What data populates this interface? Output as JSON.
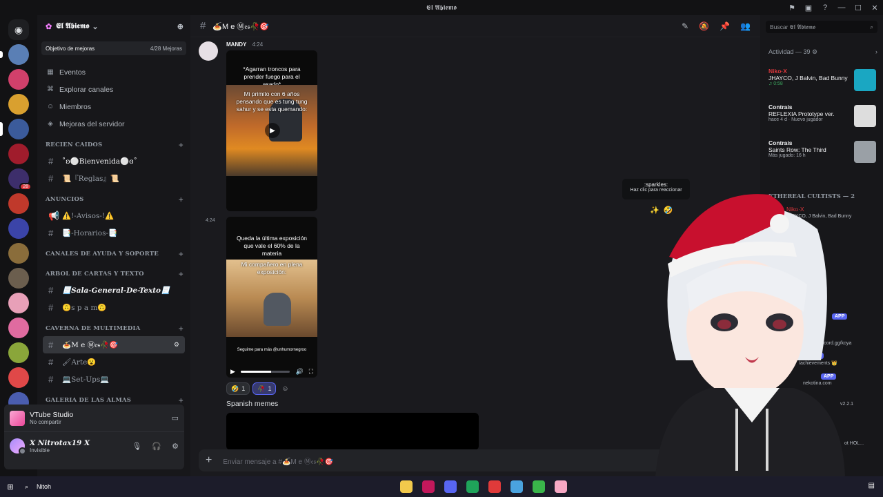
{
  "window": {
    "title": "𝕰𝖑 𝕬𝖇𝖎𝖊𝖒𝖔",
    "controls": [
      "—",
      "☐",
      "✕"
    ]
  },
  "server": {
    "name": "𝕰𝖑 𝕬𝖇𝖎𝖊𝖒𝖔",
    "boost_label": "Objetivo de mejoras",
    "boost_count": "4/28 Mejoras"
  },
  "menu": [
    {
      "icon": "calendar-icon",
      "glyph": "▦",
      "label": "Eventos"
    },
    {
      "icon": "compass-icon",
      "glyph": "⌘",
      "label": "Explorar canales"
    },
    {
      "icon": "members-icon",
      "glyph": "☺",
      "label": "Miembros"
    },
    {
      "icon": "boost-icon",
      "glyph": "◈",
      "label": "Mejoras del servidor"
    }
  ],
  "categories": [
    {
      "label": "RECIEN CAIDOS",
      "channels": [
        {
          "name": "˚ʚ⚪Bienvenida⚪ɞ˚",
          "icon": "#",
          "state": "unread"
        },
        {
          "name": "📜『Reglas』📜",
          "icon": "#",
          "state": "normal"
        }
      ]
    },
    {
      "label": "ANUNCIOS",
      "channels": [
        {
          "name": "⚠️!-Avisos-!⚠️",
          "icon": "📢",
          "state": "normal"
        },
        {
          "name": "📑-Horarios-📑",
          "icon": "#",
          "state": "normal"
        }
      ]
    },
    {
      "label": "CANALES DE AYUDA Y SOPORTE",
      "channels": []
    },
    {
      "label": "ARBOL DE CARTAS Y TEXTO",
      "channels": [
        {
          "name": "📃Sala-General-De-Texto📃",
          "icon": "#",
          "state": "unread"
        },
        {
          "name": "🙃s p a m🙃",
          "icon": "#",
          "state": "normal"
        }
      ]
    },
    {
      "label": "CAVERNA DE MULTIMEDIA",
      "channels": [
        {
          "name": "🍝M e Ⓜ𝔢𝔰🥀🎯",
          "icon": "#",
          "state": "active"
        },
        {
          "name": "🖌Arte😮",
          "icon": "#",
          "state": "normal"
        },
        {
          "name": "💻Set-Ups💻",
          "icon": "#",
          "state": "normal"
        }
      ]
    },
    {
      "label": "GALERIA DE LAS ALMAS",
      "channels": []
    }
  ],
  "voice": {
    "app": "VTube Studio",
    "status": "No compartir"
  },
  "user": {
    "name": "𝑿 𝑵𝒊𝒕𝒓𝒐𝒕𝒂𝒙19 𝑿",
    "status": "Invisible"
  },
  "chat": {
    "channel_title": "🍝M e Ⓜ𝔢𝔰🥀🎯",
    "author": "MANDY",
    "time": "4:24",
    "time2": "4:24",
    "video1_caption_top": "*Agarran troncos para prender fuego para el asado*",
    "video1_caption_mid": "Mi primito con 6 años pensando que es tung tung sahur y se esta quemando:",
    "video2_caption_top": "Queda la última exposición que vale el 60% de la materia",
    "video2_caption_mid": "Mi compañero en plena exposición:",
    "video2_caption_bottom": "Seguime para más @unhumornegroo",
    "video2_progress": 0.62,
    "reactions": [
      {
        "emoji": "🤣",
        "count": "1",
        "mine": false
      },
      {
        "emoji": "🥀",
        "count": "1",
        "mine": true
      }
    ],
    "text": "Spanish memes",
    "composer_placeholder": "Enviar mensaje a #🍝M e Ⓜ𝔢𝔰🥀🎯",
    "tooltip_title": ":sparkles:",
    "tooltip_sub": "Haz clic para reaccionar"
  },
  "members": {
    "search_placeholder": "Buscar 𝕰𝖑 𝕬𝖇𝖎𝖊𝖒𝖔",
    "activity_header": "Actividad — 39",
    "activities": [
      {
        "name": "Niko·X",
        "game": "JHAYCO, J Balvin, Bad Bunny",
        "meta": "♫ 0:58",
        "thumb": "#1aa7c2"
      },
      {
        "name": "Contrais",
        "game": "REFLEXIA Prototype ver.",
        "meta": "hace 4 d · Nuevo jugador",
        "thumb": "#dddddd"
      },
      {
        "name": "Contrais",
        "game": "Saints Row: The Third",
        "meta": "Más jugado: 16 h",
        "thumb": "#9aa0a6"
      }
    ],
    "group_label": "ETHEREAL CULTISTS — 2",
    "member1": {
      "name": "Niko·X",
      "status": "JHAYCO, J Balvin, Bad Bunny"
    },
    "app_tag": "APP",
    "status_texts": [
      "ya.gg · discord.gg/koya",
      "/achievements 👑",
      "nekotina.com",
      "v2.2.1",
      "ot HOL..."
    ]
  },
  "taskbar": {
    "search_text": "Nitoh"
  }
}
